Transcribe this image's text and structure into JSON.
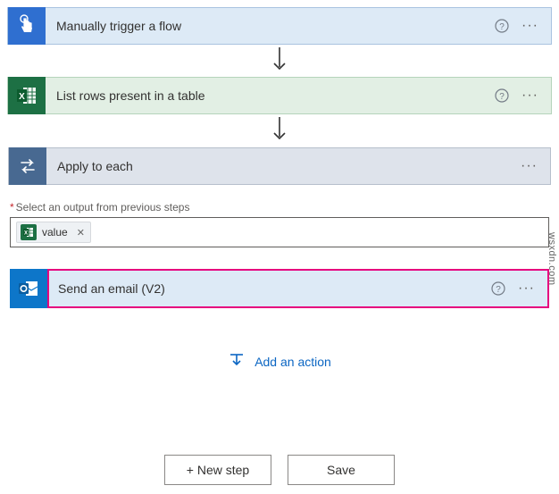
{
  "watermark": "wsxdn.com",
  "steps": {
    "trigger": {
      "title": "Manually trigger a flow"
    },
    "excel": {
      "title": "List rows present in a table"
    },
    "foreach": {
      "title": "Apply to each",
      "field_label": "Select an output from previous steps",
      "token": {
        "label": "value"
      }
    },
    "outlook": {
      "title": "Send an email (V2)"
    }
  },
  "buttons": {
    "add_action": "Add an action",
    "new_step": "+ New step",
    "save": "Save"
  }
}
